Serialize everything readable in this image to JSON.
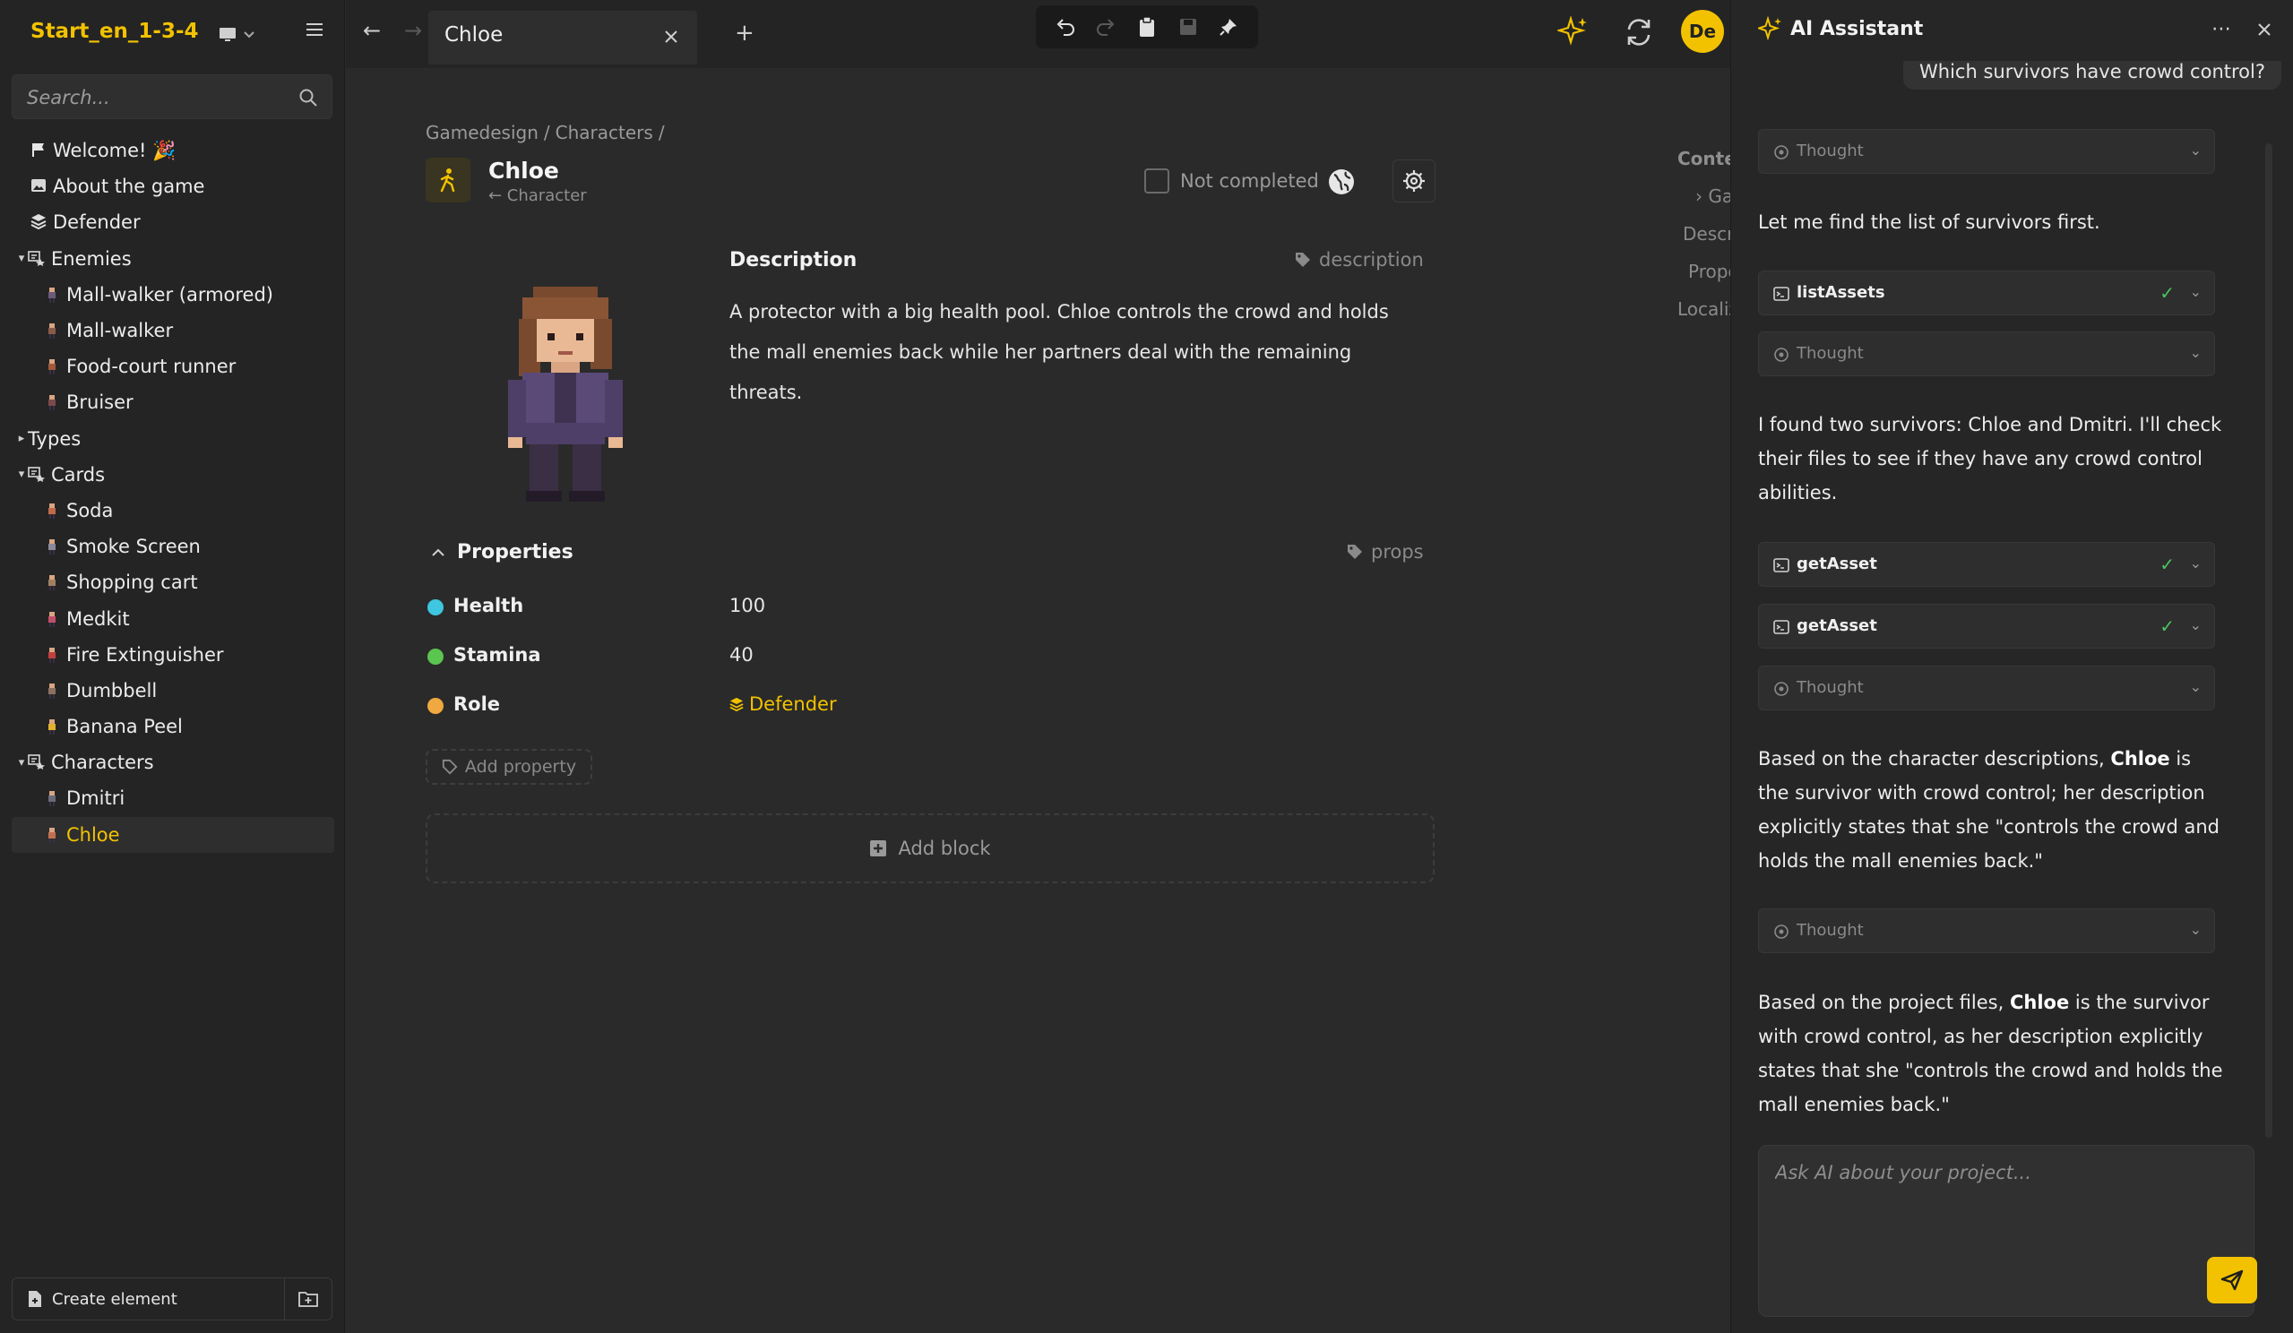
{
  "project": {
    "name": "Start_en_1-3-4"
  },
  "sidebar": {
    "search_placeholder": "Search...",
    "tree": [
      {
        "label": "Welcome! 🎉",
        "icon": "flag-icon",
        "level": 0,
        "folder": false
      },
      {
        "label": "About the game",
        "icon": "image-icon",
        "level": 0,
        "folder": false
      },
      {
        "label": "Defender",
        "icon": "layers-icon",
        "level": 0,
        "folder": false
      },
      {
        "label": "Enemies",
        "icon": "folder-icon",
        "level": 0,
        "folder": true
      },
      {
        "label": "Mall-walker (armored)",
        "icon": "sprite-icon",
        "level": 1
      },
      {
        "label": "Mall-walker",
        "icon": "sprite-icon",
        "level": 1
      },
      {
        "label": "Food-court runner",
        "icon": "sprite-icon",
        "level": 1
      },
      {
        "label": "Bruiser",
        "icon": "sprite-icon",
        "level": 1
      },
      {
        "label": "Types",
        "icon": "",
        "level": 0,
        "folder": true,
        "collapsed": true
      },
      {
        "label": "Cards",
        "icon": "folder-icon",
        "level": 0,
        "folder": true
      },
      {
        "label": "Soda",
        "icon": "sprite-icon",
        "level": 1
      },
      {
        "label": "Smoke Screen",
        "icon": "sprite-icon",
        "level": 1
      },
      {
        "label": "Shopping cart",
        "icon": "sprite-icon",
        "level": 1
      },
      {
        "label": "Medkit",
        "icon": "sprite-icon",
        "level": 1
      },
      {
        "label": "Fire Extinguisher",
        "icon": "sprite-icon",
        "level": 1
      },
      {
        "label": "Dumbbell",
        "icon": "sprite-icon",
        "level": 1
      },
      {
        "label": "Banana Peel",
        "icon": "sprite-icon",
        "level": 1
      },
      {
        "label": "Characters",
        "icon": "folder-icon",
        "level": 0,
        "folder": true
      },
      {
        "label": "Dmitri",
        "icon": "sprite-icon",
        "level": 1
      },
      {
        "label": "Chloe",
        "icon": "sprite-icon",
        "level": 1,
        "active": true
      }
    ],
    "create_label": "Create element"
  },
  "tabs": [
    {
      "label": "Chloe",
      "active": true
    }
  ],
  "user": {
    "initials": "De"
  },
  "document": {
    "breadcrumb": [
      "Gamedesign",
      "/",
      "Characters",
      "/"
    ],
    "title": "Chloe",
    "type_label": "← Character",
    "status_label": "Not completed",
    "description": {
      "heading": "Description",
      "tag": "description",
      "text": "A protector with a big health pool. Chloe controls the crowd and holds the mall enemies back while her partners deal with the remaining threats."
    },
    "properties": {
      "heading": "Properties",
      "tag": "props",
      "rows": [
        {
          "name": "Health",
          "value": "100",
          "color": "#3fc6e0"
        },
        {
          "name": "Stamina",
          "value": "40",
          "color": "#5ac54f"
        },
        {
          "name": "Role",
          "value": "Defender",
          "color": "#f0a840",
          "link": true
        }
      ],
      "add_label": "Add property"
    },
    "add_block_label": "Add block",
    "toc": [
      "Conte",
      "› Ga",
      "Descrip",
      "Prope",
      "Localiza"
    ]
  },
  "ai": {
    "title": "AI Assistant",
    "user_message": "Which survivors have crowd control?",
    "thought_label": "Thought",
    "tool_list": "listAssets",
    "tool_get": "getAsset",
    "msg1": "Let me find the list of survivors first.",
    "msg2": "I found two survivors: Chloe and Dmitri. I'll check their files to see if they have any crowd control abilities.",
    "msg3_pre": "Based on the character descriptions, ",
    "msg3_bold": "Chloe",
    "msg3_post": " is the survivor with crowd control; her description explicitly states that she \"controls the crowd and holds the mall enemies back.\"",
    "msg4_pre": "Based on the project files, ",
    "msg4_bold": "Chloe",
    "msg4_post": " is the survivor with crowd control, as her description explicitly states that she \"controls the crowd and holds the mall enemies back.\"",
    "input_placeholder": "Ask AI about your project..."
  },
  "colors": {
    "accent": "#f2c200",
    "bg": "#2a2a2a",
    "sidebar": "#242424"
  }
}
